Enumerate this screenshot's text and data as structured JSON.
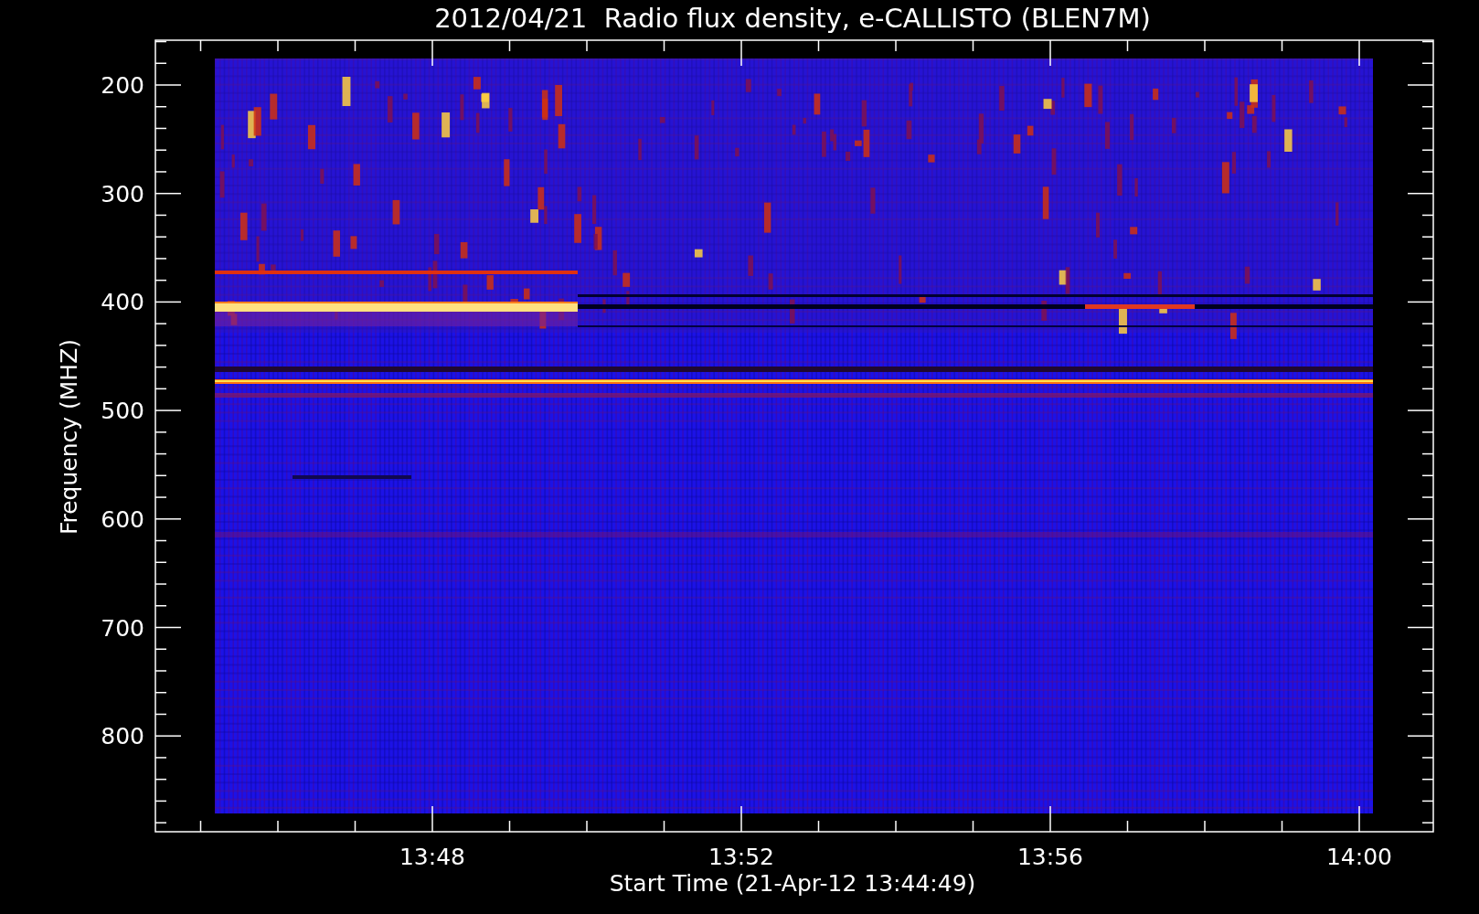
{
  "title": "2012/04/21  Radio flux density, e-CALLISTO (BLEN7M)",
  "ylabel": "Frequency (MHZ)",
  "xlabel": "Start Time (21-Apr-12 13:44:49)",
  "y_ticks": [
    "200",
    "300",
    "400",
    "500",
    "600",
    "700",
    "800"
  ],
  "x_ticks": [
    "13:48",
    "13:52",
    "13:56",
    "14:00"
  ]
}
